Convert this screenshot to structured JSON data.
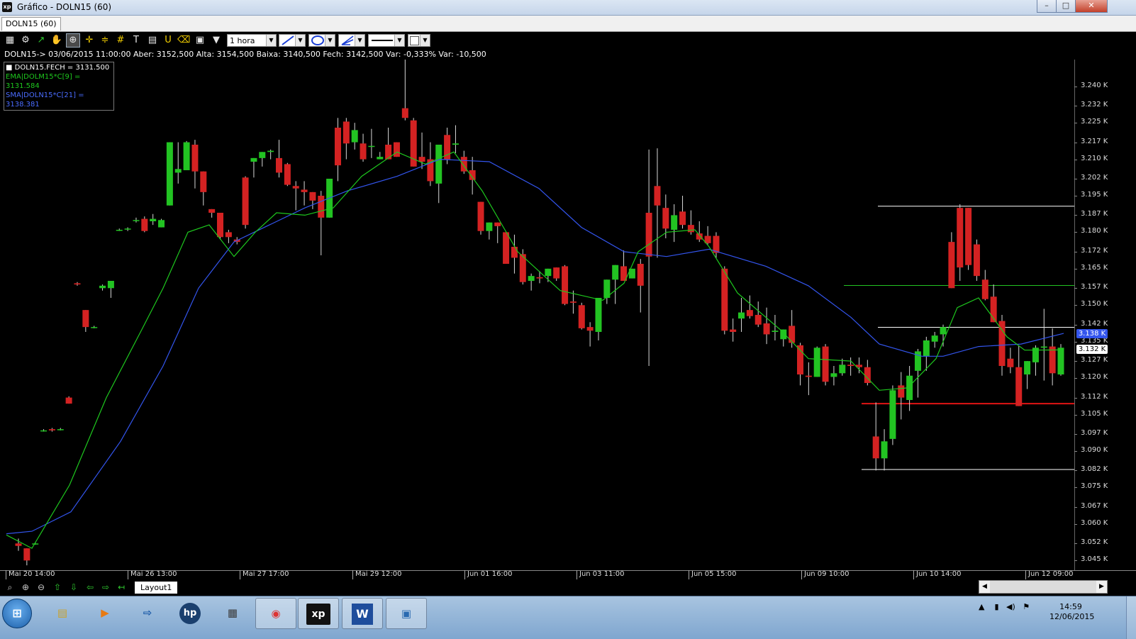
{
  "window": {
    "title": "Gráfico - DOLN15 (60)",
    "app_icon": "xp",
    "buttons": [
      "–",
      "□",
      "✕"
    ]
  },
  "tabs": [
    "DOLN15 (60)"
  ],
  "toolbar": {
    "interval": "1 hora"
  },
  "info_line": "DOLN15-> 03/06/2015 11:00:00 Aber: 3152,500 Alta: 3154,500 Baixa: 3140,500 Fech: 3142,500 Var: -0,333% Var: -10,500",
  "legend": {
    "close": "DOLN15.FECH = 3131.500",
    "ema": "EMA|DOLM15*C[9] = 3131.584",
    "sma": "SMA|DOLN15*C[21] = 3138.381"
  },
  "colors": {
    "up": "#22c322",
    "down": "#d42222",
    "ema": "#1ec81e",
    "sma": "#3355ee",
    "hline_white": "#ffffff",
    "hline_green": "#22c322",
    "hline_red": "#e01414"
  },
  "chart_data": {
    "type": "candlestick",
    "y_labels": [
      "3.240 K",
      "3.232 K",
      "3.225 K",
      "3.217 K",
      "3.210 K",
      "3.202 K",
      "3.195 K",
      "3.187 K",
      "3.180 K",
      "3.172 K",
      "3.165 K",
      "3.157 K",
      "3.150 K",
      "3.142 K",
      "3.135 K",
      "3.127 K",
      "3.120 K",
      "3.112 K",
      "3.105 K",
      "3.097 K",
      "3.090 K",
      "3.082 K",
      "3.075 K",
      "3.067 K",
      "3.060 K",
      "3.052 K",
      "3.045 K"
    ],
    "ylim": [
      3041,
      3251
    ],
    "x_labels": [
      "Mai 20 14:00",
      "Mai 26 13:00",
      "Mai 27 17:00",
      "Mai 29 12:00",
      "Jun 01 16:00",
      "Jun 03 11:00",
      "Jun 05 15:00",
      "Jun 09 10:00",
      "Jun 10 14:00",
      "Jun 12 09:00"
    ],
    "badges": [
      {
        "text": "3.138 K",
        "value": 3138.4,
        "bg": "#3355ee",
        "fg": "#ffffff"
      },
      {
        "text": "3.132 K",
        "value": 3132.0,
        "bg": "#ffffff",
        "fg": "#000000"
      }
    ],
    "candles": [
      [
        3052.0,
        3054.0,
        3049.0,
        3051.0
      ],
      [
        3050.0,
        3049.5,
        3043.0,
        3045.0
      ],
      [
        3052.0,
        3052.5,
        3051.5,
        3052.0
      ],
      [
        3098.5,
        3099.0,
        3098.0,
        3098.5
      ],
      [
        3099.0,
        3099.5,
        3098.0,
        3098.5
      ],
      [
        3099.0,
        3099.5,
        3098.5,
        3099.0
      ],
      [
        3112.0,
        3112.5,
        3110.0,
        3109.5
      ],
      [
        3159.0,
        3159.5,
        3158.0,
        3158.5
      ],
      [
        3148.0,
        3146.0,
        3139.0,
        3141.0
      ],
      [
        3141.0,
        3141.5,
        3140.5,
        3141.0
      ],
      [
        3157.0,
        3158.5,
        3156.0,
        3158.0
      ],
      [
        3157.0,
        3159.5,
        3153.0,
        3160.0
      ],
      [
        3181.0,
        3181.5,
        3180.5,
        3181.0
      ],
      [
        3181.5,
        3182.0,
        3180.5,
        3181.5
      ],
      [
        3185.0,
        3186.0,
        3184.0,
        3185.0
      ],
      [
        3185.5,
        3186.5,
        3180.0,
        3180.5
      ],
      [
        3184.5,
        3187.5,
        3183.0,
        3185.5
      ],
      [
        3182.0,
        3185.5,
        3183.5,
        3185.0
      ],
      [
        3191.0,
        3217.0,
        3191.0,
        3217.0
      ],
      [
        3204.5,
        3217.0,
        3200.0,
        3206.0
      ],
      [
        3205.5,
        3217.5,
        3207.0,
        3217.0
      ],
      [
        3216.0,
        3218.0,
        3198.0,
        3205.0
      ],
      [
        3205.0,
        3201.0,
        3191.0,
        3196.5
      ],
      [
        3189.5,
        3188.5,
        3186.0,
        3188.0
      ],
      [
        3188.0,
        3188.0,
        3177.0,
        3178.0
      ],
      [
        3180.0,
        3181.0,
        3175.5,
        3178.0
      ],
      [
        3177.0,
        3178.0,
        3175.0,
        3176.0
      ],
      [
        3202.5,
        3203.0,
        3181.5,
        3183.0
      ],
      [
        3209.0,
        3210.0,
        3202.5,
        3210.5
      ],
      [
        3210.5,
        3212.5,
        3207.0,
        3213.0
      ],
      [
        3213.0,
        3214.0,
        3210.0,
        3213.5
      ],
      [
        3210.5,
        3218.0,
        3202.5,
        3204.5
      ],
      [
        3208.0,
        3208.5,
        3199.0,
        3199.5
      ],
      [
        3199.0,
        3201.0,
        3189.0,
        3198.0
      ],
      [
        3197.5,
        3201.0,
        3191.0,
        3196.5
      ],
      [
        3196.5,
        3193.5,
        3189.5,
        3193.0
      ],
      [
        3195.0,
        3197.0,
        3170.5,
        3186.0
      ],
      [
        3186.0,
        3199.0,
        3186.0,
        3202.0
      ],
      [
        3223.0,
        3227.0,
        3201.0,
        3207.5
      ],
      [
        3225.5,
        3227.0,
        3210.0,
        3216.5
      ],
      [
        3217.0,
        3225.0,
        3214.0,
        3222.0
      ],
      [
        3216.5,
        3220.5,
        3209.0,
        3210.0
      ],
      [
        3215.5,
        3222.5,
        3210.5,
        3215.5
      ],
      [
        3210.0,
        3213.0,
        3214.0,
        3211.0
      ],
      [
        3216.0,
        3223.0,
        3211.0,
        3210.0
      ],
      [
        3217.0,
        3217.0,
        3211.0,
        3211.0
      ],
      [
        3231.0,
        3251.0,
        3226.0,
        3227.0
      ],
      [
        3226.0,
        3227.0,
        3208.0,
        3207.0
      ],
      [
        3211.0,
        3221.0,
        3206.0,
        3209.0
      ],
      [
        3210.0,
        3217.0,
        3199.0,
        3201.0
      ],
      [
        3200.0,
        3214.0,
        3192.0,
        3216.0
      ],
      [
        3220.0,
        3223.0,
        3208.0,
        3210.0
      ],
      [
        3216.0,
        3224.0,
        3212.5,
        3216.5
      ],
      [
        3211.0,
        3213.5,
        3204.0,
        3205.0
      ],
      [
        3205.5,
        3211.0,
        3195.5,
        3201.5
      ],
      [
        3192.5,
        3191.5,
        3179.0,
        3180.5
      ],
      [
        3180.5,
        3184.0,
        3177.0,
        3184.0
      ],
      [
        3184.0,
        3184.0,
        3175.5,
        3182.5
      ],
      [
        3180.0,
        3180.0,
        3167.5,
        3167.0
      ],
      [
        3174.0,
        3179.0,
        3163.0,
        3169.5
      ],
      [
        3171.0,
        3173.0,
        3158.5,
        3159.5
      ],
      [
        3160.0,
        3163.0,
        3156.0,
        3162.0
      ],
      [
        3161.5,
        3164.0,
        3159.0,
        3161.0
      ],
      [
        3162.0,
        3163.0,
        3159.5,
        3165.0
      ],
      [
        3165.5,
        3165.0,
        3160.0,
        3161.0
      ],
      [
        3166.0,
        3166.5,
        3150.0,
        3150.5
      ],
      [
        3151.5,
        3156.0,
        3146.5,
        3151.0
      ],
      [
        3150.0,
        3151.0,
        3140.0,
        3140.5
      ],
      [
        3141.0,
        3143.0,
        3133.0,
        3139.5
      ],
      [
        3139.0,
        3151.0,
        3135.5,
        3153.0
      ],
      [
        3153.0,
        3160.0,
        3150.5,
        3160.5
      ],
      [
        3160.5,
        3166.5,
        3150.5,
        3166.5
      ],
      [
        3166.0,
        3172.5,
        3160.5,
        3160.0
      ],
      [
        3161.0,
        3165.0,
        3161.0,
        3165.0
      ],
      [
        3167.0,
        3169.0,
        3147.0,
        3158.0
      ],
      [
        3188.0,
        3214.0,
        3125.0,
        3170.0
      ],
      [
        3199.0,
        3214.5,
        3169.5,
        3191.0
      ],
      [
        3190.0,
        3195.5,
        3177.5,
        3181.5
      ],
      [
        3181.0,
        3191.5,
        3176.0,
        3187.0
      ],
      [
        3188.5,
        3195.0,
        3181.5,
        3183.0
      ],
      [
        3183.0,
        3189.0,
        3179.0,
        3180.0
      ],
      [
        3179.5,
        3184.5,
        3176.0,
        3177.0
      ],
      [
        3178.5,
        3182.5,
        3175.0,
        3175.5
      ],
      [
        3178.5,
        3180.0,
        3169.5,
        3171.5
      ],
      [
        3165.0,
        3166.0,
        3138.0,
        3139.5
      ],
      [
        3140.0,
        3144.5,
        3135.0,
        3139.0
      ],
      [
        3144.5,
        3153.0,
        3139.0,
        3147.0
      ],
      [
        3148.0,
        3154.0,
        3144.5,
        3145.5
      ],
      [
        3146.0,
        3151.5,
        3141.0,
        3142.0
      ],
      [
        3142.5,
        3149.0,
        3134.0,
        3138.0
      ],
      [
        3139.0,
        3146.0,
        3135.5,
        3139.5
      ],
      [
        3136.0,
        3139.0,
        3133.0,
        3140.0
      ],
      [
        3141.5,
        3148.0,
        3132.5,
        3134.5
      ],
      [
        3133.5,
        3134.5,
        3117.0,
        3121.5
      ],
      [
        3121.0,
        3126.5,
        3113.0,
        3120.5
      ],
      [
        3120.5,
        3133.0,
        3120.5,
        3132.5
      ],
      [
        3133.0,
        3134.0,
        3117.0,
        3118.5
      ],
      [
        3120.5,
        3125.0,
        3117.0,
        3122.0
      ],
      [
        3122.0,
        3128.0,
        3121.0,
        3125.5
      ],
      [
        3125.5,
        3128.5,
        3121.0,
        3125.0
      ],
      [
        3125.5,
        3128.5,
        3122.0,
        3124.5
      ],
      [
        3124.5,
        3127.5,
        3117.0,
        3118.0
      ],
      [
        3096.0,
        3110.0,
        3082.0,
        3087.0
      ],
      [
        3087.0,
        3099.0,
        3082.0,
        3094.0
      ],
      [
        3095.0,
        3117.0,
        3092.5,
        3115.0
      ],
      [
        3117.0,
        3122.5,
        3103.0,
        3112.0
      ],
      [
        3111.0,
        3125.0,
        3106.5,
        3121.0
      ],
      [
        3123.0,
        3132.0,
        3112.0,
        3131.0
      ],
      [
        3129.0,
        3137.0,
        3123.0,
        3135.5
      ],
      [
        3135.0,
        3139.0,
        3132.5,
        3137.5
      ],
      [
        3138.0,
        3142.0,
        3133.0,
        3141.0
      ],
      [
        3176.0,
        3180.0,
        3158.0,
        3157.0
      ],
      [
        3190.0,
        3191.5,
        3160.0,
        3165.5
      ],
      [
        3190.0,
        3190.0,
        3164.5,
        3166.5
      ],
      [
        3175.0,
        3177.0,
        3160.0,
        3162.0
      ],
      [
        3160.5,
        3164.5,
        3152.0,
        3152.5
      ],
      [
        3153.5,
        3158.5,
        3143.5,
        3143.0
      ],
      [
        3143.5,
        3146.0,
        3121.0,
        3125.0
      ],
      [
        3128.0,
        3132.5,
        3122.0,
        3124.5
      ],
      [
        3124.5,
        3133.5,
        3111.0,
        3108.5
      ],
      [
        3121.5,
        3126.5,
        3115.5,
        3127.0
      ],
      [
        3126.5,
        3133.5,
        3121.0,
        3132.5
      ],
      [
        3132.5,
        3148.5,
        3119.0,
        3133.0
      ],
      [
        3133.0,
        3140.5,
        3117.0,
        3122.0
      ],
      [
        3121.5,
        3134.0,
        3121.0,
        3132.5
      ]
    ],
    "ema_points": [
      [
        9,
        3055.5
      ],
      [
        45,
        3050
      ],
      [
        98,
        3076
      ],
      [
        150,
        3112
      ],
      [
        200,
        3140
      ],
      [
        230,
        3157
      ],
      [
        265,
        3180
      ],
      [
        295,
        3183
      ],
      [
        330,
        3170
      ],
      [
        360,
        3180
      ],
      [
        390,
        3188
      ],
      [
        430,
        3187
      ],
      [
        470,
        3190
      ],
      [
        510,
        3203
      ],
      [
        560,
        3213
      ],
      [
        600,
        3208
      ],
      [
        640,
        3213
      ],
      [
        680,
        3197
      ],
      [
        730,
        3172
      ],
      [
        790,
        3156
      ],
      [
        850,
        3152
      ],
      [
        880,
        3159
      ],
      [
        900,
        3172
      ],
      [
        940,
        3180
      ],
      [
        980,
        3181
      ],
      [
        1000,
        3174
      ],
      [
        1040,
        3155
      ],
      [
        1100,
        3140
      ],
      [
        1140,
        3128
      ],
      [
        1200,
        3127
      ],
      [
        1240,
        3115
      ],
      [
        1280,
        3116
      ],
      [
        1320,
        3128
      ],
      [
        1350,
        3149
      ],
      [
        1380,
        3153
      ],
      [
        1420,
        3137
      ],
      [
        1445,
        3131.5
      ],
      [
        1500,
        3131.6
      ]
    ],
    "sma_points": [
      [
        9,
        3056
      ],
      [
        45,
        3057
      ],
      [
        100,
        3065
      ],
      [
        170,
        3094
      ],
      [
        230,
        3125
      ],
      [
        280,
        3157
      ],
      [
        330,
        3176
      ],
      [
        380,
        3183
      ],
      [
        430,
        3190
      ],
      [
        490,
        3197
      ],
      [
        560,
        3203
      ],
      [
        620,
        3210
      ],
      [
        690,
        3209
      ],
      [
        760,
        3198
      ],
      [
        820,
        3182
      ],
      [
        880,
        3172
      ],
      [
        940,
        3170
      ],
      [
        1000,
        3173
      ],
      [
        1080,
        3166
      ],
      [
        1140,
        3158
      ],
      [
        1200,
        3145
      ],
      [
        1240,
        3134
      ],
      [
        1300,
        3129
      ],
      [
        1330,
        3129
      ],
      [
        1380,
        3133
      ],
      [
        1440,
        3134
      ],
      [
        1500,
        3138.4
      ]
    ],
    "hlines": [
      {
        "x1": 1238,
        "x2": 1515,
        "value": 3190.7,
        "color": "white"
      },
      {
        "x1": 1190,
        "x2": 1515,
        "value": 3158.1,
        "color": "green"
      },
      {
        "x1": 1238,
        "x2": 1515,
        "value": 3140.9,
        "color": "white"
      },
      {
        "x1": 1215,
        "x2": 1515,
        "value": 3109.5,
        "color": "red"
      },
      {
        "x1": 1215,
        "x2": 1515,
        "value": 3082.4,
        "color": "white"
      }
    ]
  },
  "bottom": {
    "layout_tab": "Layout1"
  },
  "taskbar": {
    "apps": [
      "explorer",
      "media",
      "network",
      "hp",
      "tool",
      "chrome",
      "xp",
      "word",
      "monitor"
    ],
    "app_glyphs": [
      "▤",
      "▶",
      "⇨",
      "hp",
      "▦",
      "◉",
      "xp",
      "W",
      "▣"
    ],
    "tray_icons": [
      "▲",
      "▮",
      "◀)",
      "⚑"
    ],
    "time": "14:59",
    "date": "12/06/2015"
  }
}
